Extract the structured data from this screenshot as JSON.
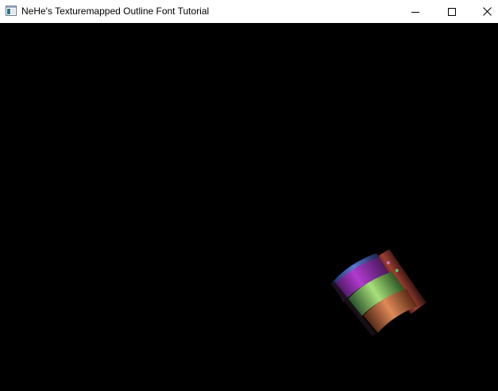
{
  "window": {
    "title": "NeHe's Texturemapped Outline Font Tutorial",
    "controls": {
      "minimize_icon": "minimize-icon",
      "maximize_icon": "maximize-icon",
      "close_icon": "close-icon"
    }
  },
  "viewport": {
    "background": "#000000",
    "content": "rotating-3d-text-object"
  }
}
